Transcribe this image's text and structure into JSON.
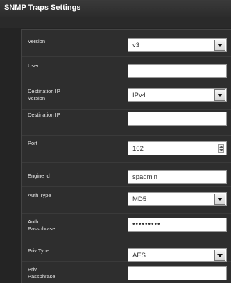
{
  "window": {
    "title": "SNMP Traps Settings"
  },
  "form": {
    "version": {
      "label": "Version",
      "value": "v3"
    },
    "user": {
      "label": "User",
      "value": ""
    },
    "dest_ip_version": {
      "label_line1": "Destination IP",
      "label_line2": "Version",
      "value": "IPv4"
    },
    "dest_ip": {
      "label": "Destination IP",
      "value": ""
    },
    "port": {
      "label": "Port",
      "value": "162"
    },
    "engine_id": {
      "label": "Engine Id",
      "value": "spadmin"
    },
    "auth_type": {
      "label": "Auth Type",
      "value": "MD5"
    },
    "auth_passphrase": {
      "label_line1": "Auth",
      "label_line2": "Passphrase",
      "value": "•••••••••"
    },
    "priv_type": {
      "label": "Priv Type",
      "value": "AES"
    },
    "priv_passphrase": {
      "label_line1": "Priv",
      "label_line2": "Passphrase",
      "value": ""
    }
  }
}
